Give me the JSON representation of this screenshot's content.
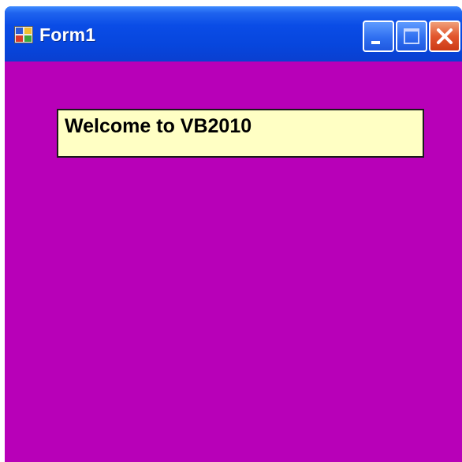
{
  "window": {
    "title": "Form1"
  },
  "controls": {
    "minimize": "minimize",
    "maximize": "maximize",
    "close": "close"
  },
  "form": {
    "background_color": "#b800b8",
    "label": {
      "text": "Welcome to VB2010",
      "background_color": "#ffffc4"
    }
  },
  "colors": {
    "titlebar": "#0746dd",
    "close_button": "#e2572e"
  }
}
